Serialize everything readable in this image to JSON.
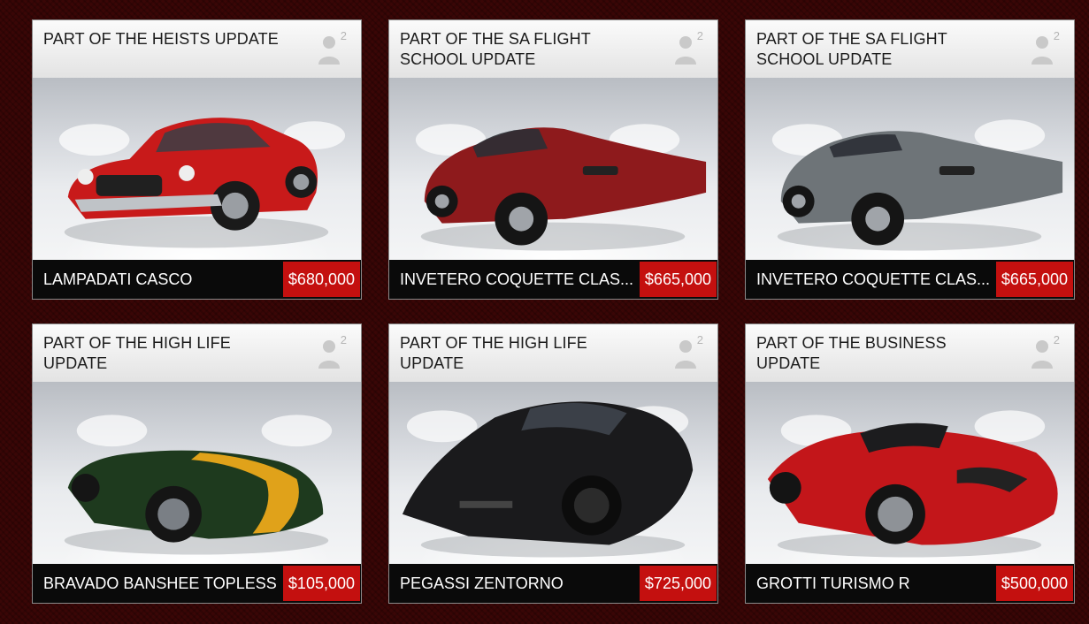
{
  "cards": [
    {
      "update": "PART OF THE HEISTS UPDATE",
      "players": "2",
      "name": "LAMPADATI CASCO",
      "price": "$680,000",
      "color": "#c81a1a"
    },
    {
      "update": "PART OF THE SA FLIGHT SCHOOL UPDATE",
      "players": "2",
      "name": "INVETERO COQUETTE CLAS...",
      "price": "$665,000",
      "color": "#8e1a1c"
    },
    {
      "update": "PART OF THE SA FLIGHT SCHOOL UPDATE",
      "players": "2",
      "name": "INVETERO COQUETTE CLAS...",
      "price": "$665,000",
      "color": "#6e7478"
    },
    {
      "update": "PART OF THE HIGH LIFE UPDATE",
      "players": "2",
      "name": "BRAVADO BANSHEE TOPLESS",
      "price": "$105,000",
      "color": "#1e3a1e"
    },
    {
      "update": "PART OF THE HIGH LIFE UPDATE",
      "players": "2",
      "name": "PEGASSI ZENTORNO",
      "price": "$725,000",
      "color": "#1a1a1c"
    },
    {
      "update": "PART OF THE BUSINESS UPDATE",
      "players": "2",
      "name": "GROTTI TURISMO R",
      "price": "$500,000",
      "color": "#c3161a"
    }
  ]
}
